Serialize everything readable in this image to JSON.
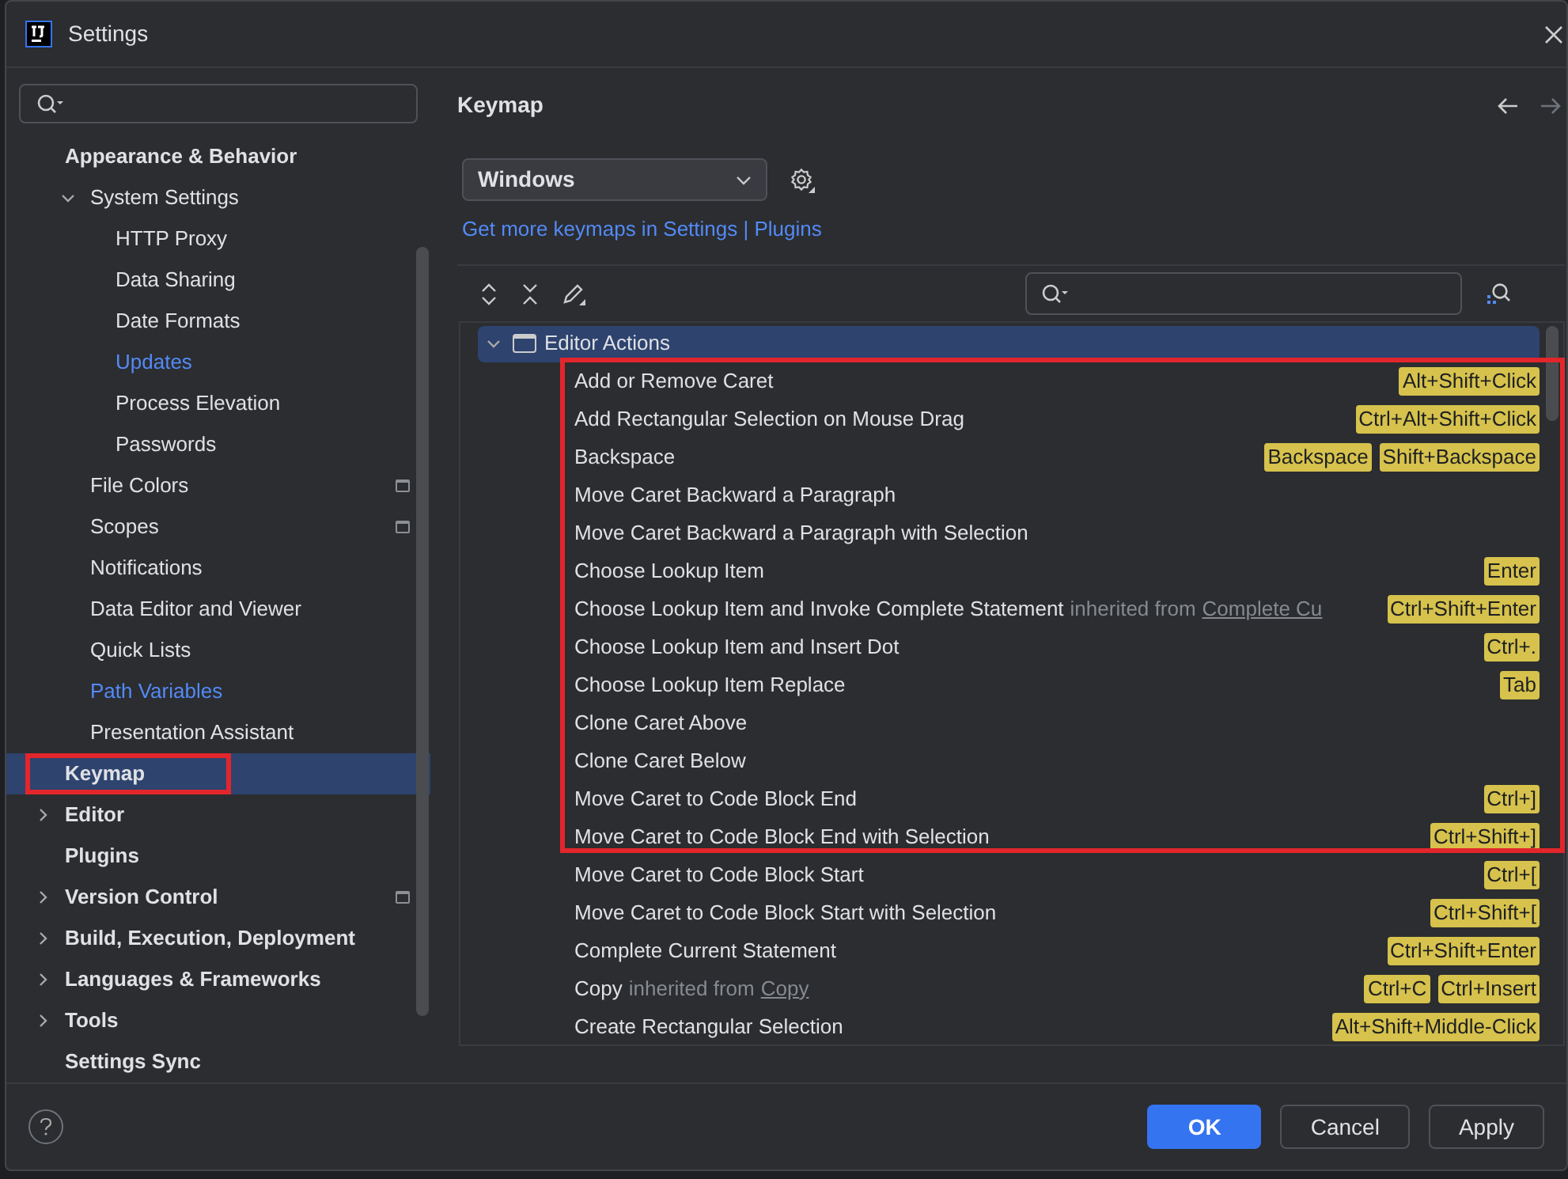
{
  "window": {
    "title": "Settings"
  },
  "sidebar": {
    "items": [
      {
        "label": "Appearance & Behavior",
        "children": [
          {
            "label": "System Settings",
            "expanded": true,
            "children": [
              {
                "label": "HTTP Proxy"
              },
              {
                "label": "Data Sharing"
              },
              {
                "label": "Date Formats"
              },
              {
                "label": "Updates",
                "modified": true
              },
              {
                "label": "Process Elevation"
              },
              {
                "label": "Passwords"
              }
            ]
          },
          {
            "label": "File Colors",
            "project_level": true
          },
          {
            "label": "Scopes",
            "project_level": true
          },
          {
            "label": "Notifications"
          },
          {
            "label": "Data Editor and Viewer"
          },
          {
            "label": "Quick Lists"
          },
          {
            "label": "Path Variables",
            "modified": true
          },
          {
            "label": "Presentation Assistant"
          }
        ]
      },
      {
        "label": "Keymap",
        "selected": true,
        "annotated": true
      },
      {
        "label": "Editor",
        "expanded": false
      },
      {
        "label": "Plugins"
      },
      {
        "label": "Version Control",
        "expanded": false,
        "project_level": true
      },
      {
        "label": "Build, Execution, Deployment",
        "expanded": false
      },
      {
        "label": "Languages & Frameworks",
        "expanded": false
      },
      {
        "label": "Tools",
        "expanded": false
      },
      {
        "label": "Settings Sync"
      }
    ]
  },
  "page": {
    "title": "Keymap",
    "rows_annotated": true,
    "keymap": "Windows",
    "link": "Get more keymaps in Settings | Plugins",
    "group": {
      "label": "Editor Actions",
      "expanded": true,
      "selected": true
    },
    "actions": [
      {
        "name": "Add or Remove Caret",
        "shortcuts": [
          "Alt+Shift+Click"
        ]
      },
      {
        "name": "Add Rectangular Selection on Mouse Drag",
        "shortcuts": [
          "Ctrl+Alt+Shift+Click"
        ]
      },
      {
        "name": "Backspace",
        "shortcuts": [
          "Backspace",
          "Shift+Backspace"
        ]
      },
      {
        "name": "Move Caret Backward a Paragraph"
      },
      {
        "name": "Move Caret Backward a Paragraph with Selection"
      },
      {
        "name": "Choose Lookup Item",
        "shortcuts": [
          "Enter"
        ]
      },
      {
        "name": "Choose Lookup Item and Invoke Complete Statement",
        "note": "inherited from",
        "source": "Complete Cu",
        "shortcuts": [
          "Ctrl+Shift+Enter"
        ]
      },
      {
        "name": "Choose Lookup Item and Insert Dot",
        "shortcuts": [
          "Ctrl+."
        ]
      },
      {
        "name": "Choose Lookup Item Replace",
        "shortcuts": [
          "Tab"
        ]
      },
      {
        "name": "Clone Caret Above"
      },
      {
        "name": "Clone Caret Below"
      },
      {
        "name": "Move Caret to Code Block End",
        "shortcuts": [
          "Ctrl+]"
        ]
      },
      {
        "name": "Move Caret to Code Block End with Selection",
        "shortcuts": [
          "Ctrl+Shift+]"
        ]
      },
      {
        "name": "Move Caret to Code Block Start",
        "shortcuts": [
          "Ctrl+["
        ]
      },
      {
        "name": "Move Caret to Code Block Start with Selection",
        "shortcuts": [
          "Ctrl+Shift+["
        ]
      },
      {
        "name": "Complete Current Statement",
        "shortcuts": [
          "Ctrl+Shift+Enter"
        ]
      },
      {
        "name": "Copy",
        "note": "inherited from",
        "source": "Copy",
        "shortcuts": [
          "Ctrl+C",
          "Ctrl+Insert"
        ]
      },
      {
        "name": "Create Rectangular Selection",
        "shortcuts": [
          "Alt+Shift+Middle-Click"
        ]
      }
    ]
  },
  "buttons": [
    {
      "label": "OK",
      "kind": "primary"
    },
    {
      "label": "Cancel",
      "kind": "secondary"
    },
    {
      "label": "Apply",
      "kind": "secondary"
    }
  ]
}
